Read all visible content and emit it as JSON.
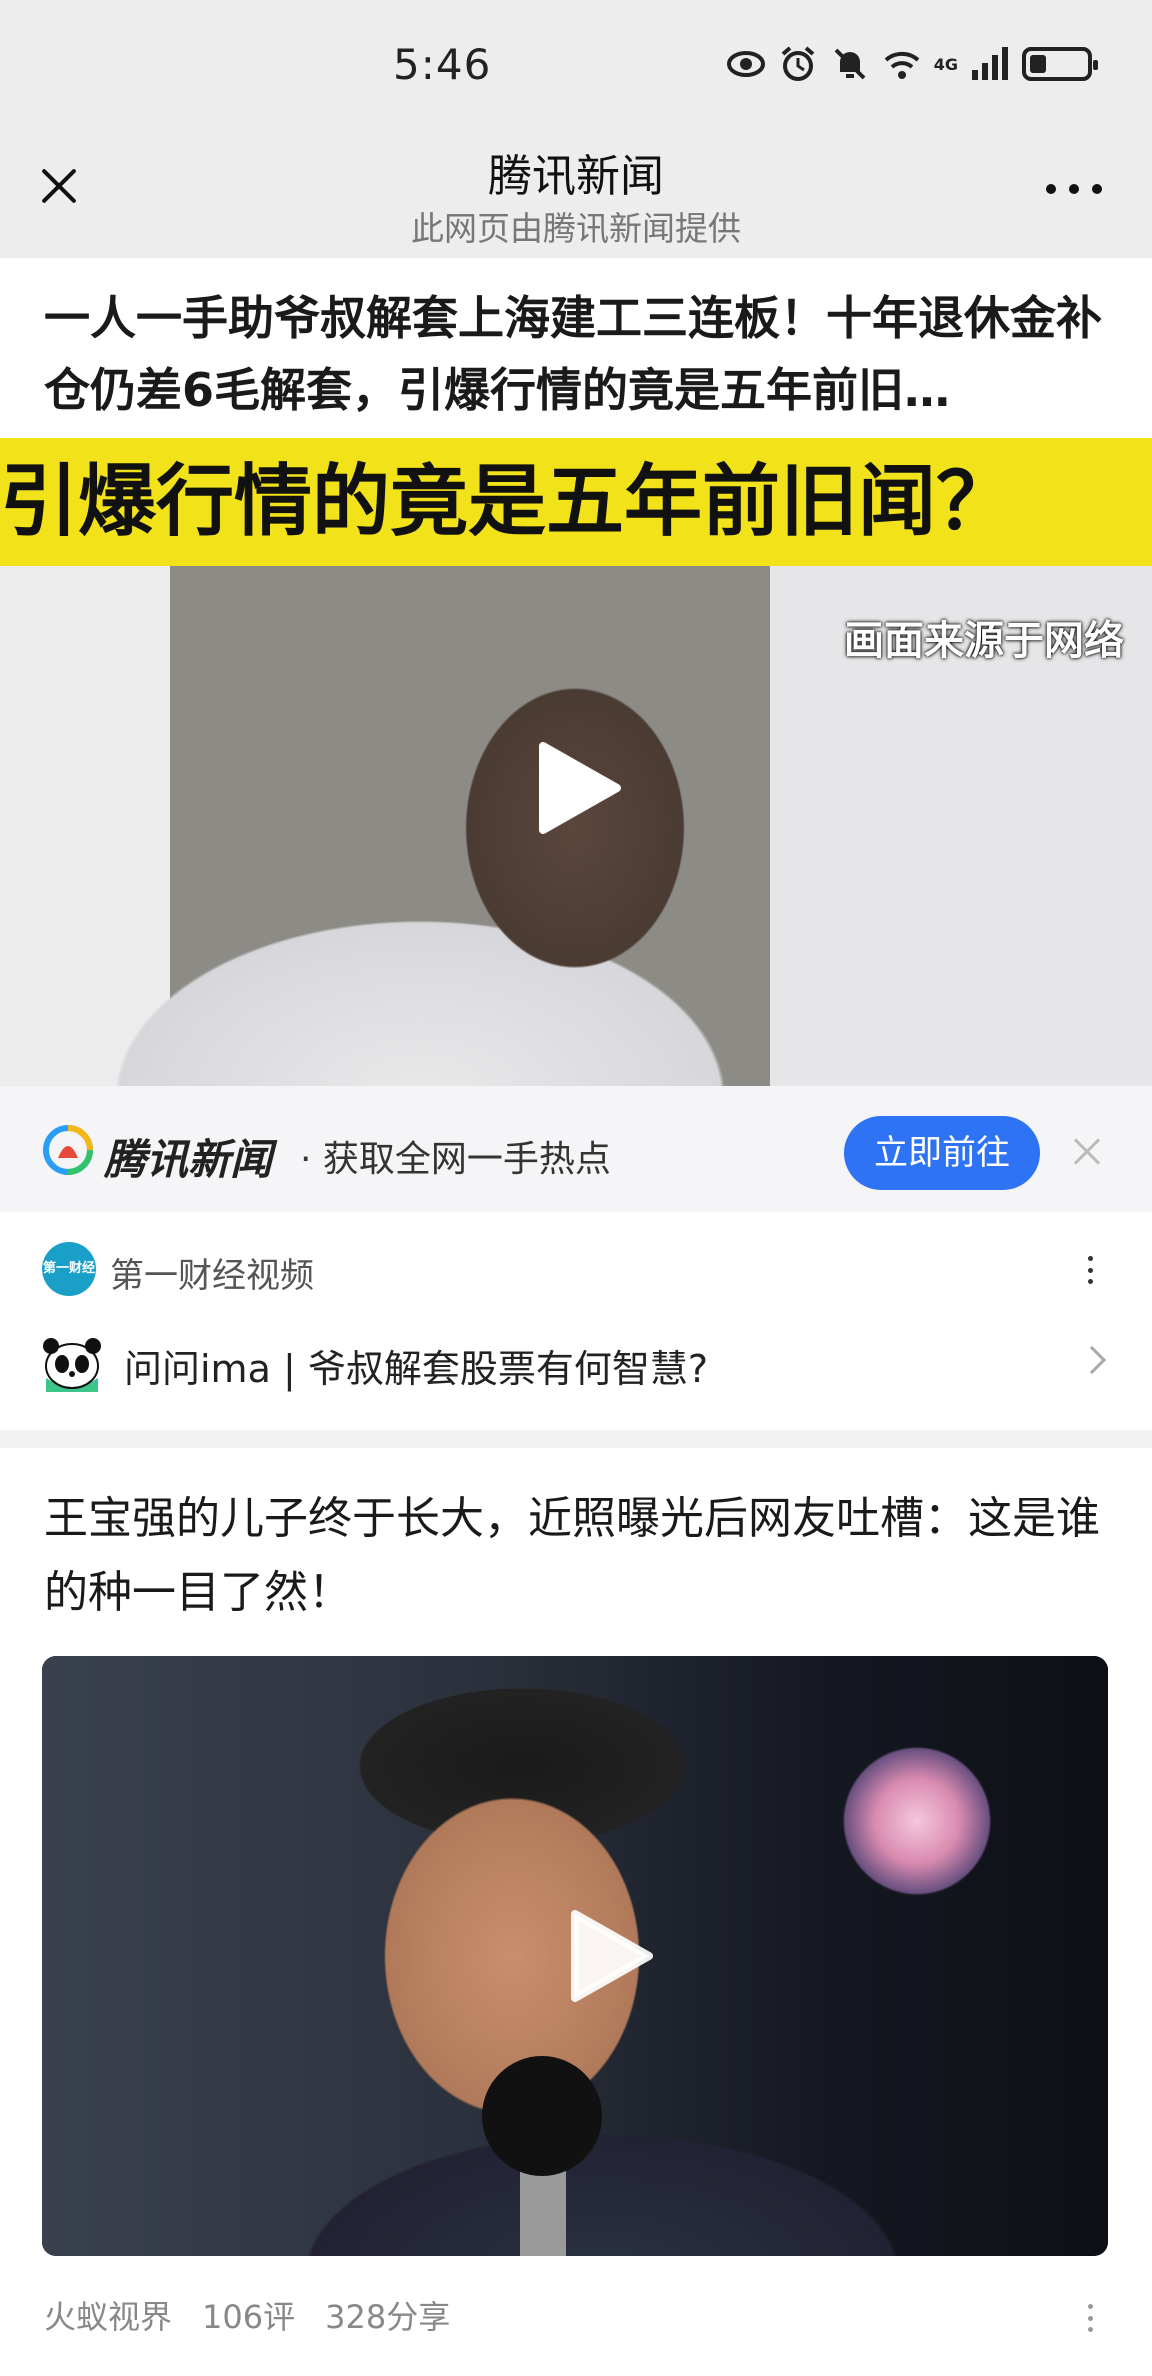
{
  "status_bar": {
    "time": "5:46",
    "network": "4G",
    "icons": [
      "eye-icon",
      "alarm-icon",
      "mute-icon",
      "wifi-icon",
      "signal-icon",
      "battery-icon"
    ],
    "battery_level": 0.3
  },
  "title_bar": {
    "title": "腾讯新闻",
    "subtitle": "此网页由腾讯新闻提供"
  },
  "article1": {
    "headline": "一人一手助爷叔解套上海建工三连板！十年退休金补仓仍差6毛解套，引爆行情的竟是五年前旧…",
    "video_banner": "引爆行情的竟是五年前旧闻？",
    "video_watermark": "画面来源于网络"
  },
  "promo": {
    "brand": "腾讯新闻",
    "text": "· 获取全网一手热点",
    "button": "立即前往",
    "accent": "#2f73f5"
  },
  "source": {
    "name": "第一财经视频",
    "avatar_text": "第一财经"
  },
  "ask": {
    "text": "问问ima | 爷叔解套股票有何智慧?"
  },
  "article2": {
    "headline": "王宝强的儿子终于长大，近照曝光后网友吐槽：这是谁的种一目了然！",
    "source": "火蚁视界",
    "comments": "106评",
    "shares": "328分享"
  }
}
